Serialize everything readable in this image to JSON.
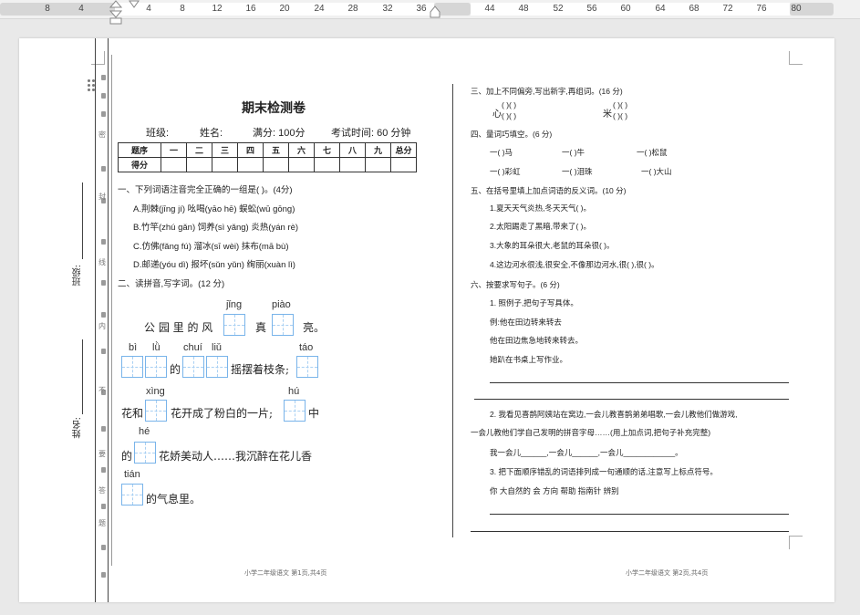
{
  "ruler": {
    "labels": [
      "8",
      "4",
      "4",
      "8",
      "12",
      "16",
      "20",
      "24",
      "28",
      "32",
      "36",
      "44",
      "48",
      "52",
      "56",
      "60",
      "64",
      "68",
      "72",
      "76",
      "80"
    ]
  },
  "exam": {
    "title": "期末检测卷",
    "info": {
      "class": "班级:",
      "name": "姓名:",
      "full_marks": "满分: 100分",
      "time": "考试时间: 60 分钟"
    },
    "score_table": {
      "row1": [
        "题序",
        "一",
        "二",
        "三",
        "四",
        "五",
        "六",
        "七",
        "八",
        "九",
        "总分"
      ],
      "row2": [
        "得分",
        "",
        "",
        "",
        "",
        "",
        "",
        "",
        "",
        "",
        ""
      ]
    }
  },
  "side": {
    "class_label": "班级:",
    "name_label": "姓名:",
    "seal_chars": [
      "密",
      "封",
      "线",
      "内",
      "不",
      "要",
      "答",
      "题"
    ]
  },
  "left": {
    "q1": {
      "title": "一、下列词语注音完全正确的一组是(    )。(4分)",
      "options": [
        "A.荆棘(jīng  jí)   吆喝(yāo  hē)   蜈蚣(wū  gōng)",
        "B.竹竿(zhú  gǎn)   饲养(sì  yǎng)   炎热(yán  rè)",
        "C.仿佛(fǎng  fú)   溜冰(sī  wèi)   抹布(mā  bù)",
        "D.邮递(yóu  dì)   报坏(sǔn  yǔn)   绚丽(xuàn  lì)"
      ]
    },
    "q2": {
      "title": "二、读拼音,写字词。(12 分)",
      "pinyin": {
        "jing": "jǐng",
        "piao": "piào",
        "bi": "bì",
        "lu": "lǜ",
        "chui": "chuí",
        "liu": "liǔ",
        "tao": "táo",
        "xing": "xìng",
        "hu": "hú",
        "he": "hé",
        "tian": "tián"
      },
      "text": {
        "l1a": "公 园 里 的 风",
        "l1b": "真",
        "l1c": "亮。",
        "l2a": "的",
        "l2b": "摇摆着枝条;",
        "l3a": "花和",
        "l3b": "花开成了粉白的一片;",
        "l3c": "中",
        "l4a": "的",
        "l4b": "花娇美动人……我沉醉在花儿香",
        "l5a": "的气息里。"
      }
    },
    "footer": "小学二年级语文  第1页,共4页"
  },
  "right": {
    "q3": {
      "title": "三、加上不同偏旁,写出新字,再组词。(16 分)",
      "char1": "心",
      "char2": "米",
      "blank": "(     )(     )"
    },
    "q4": {
      "title": "四、量词巧填空。(6 分)",
      "row1": [
        "一(      )马",
        "一(      )牛",
        "一(      )松鼠"
      ],
      "row2": [
        "一(      )彩虹",
        "一(      )泪珠",
        "一(      )大山"
      ]
    },
    "q5": {
      "title": "五、在括号里填上加点词语的反义词。(10 分)",
      "items": [
        "1.夏天天气炎热,冬天天气(      )。",
        "2.太阳踢走了黑暗,带来了(      )。",
        "3.大象的耳朵很大,老鼠的耳朵很(      )。",
        "4.这边河水很浅,很安全,不像那边河水,很(      ),很(      )。"
      ]
    },
    "q6": {
      "title": "六、按要求写句子。(6 分)",
      "s1": "1. 照例子,把句子写具体。",
      "ex1": "例:他在田边转来转去",
      "ex2": "他在田边焦急地转来转去。",
      "ex3": "她趴在书桌上写作业。",
      "s2a": "2. 我看见喜鹊阿姨站在窝边,一会儿教喜鹊弟弟唱歌,一会儿教他们做游戏,",
      "s2b": "一会儿教他们学自己发明的拼音字母……(用上加点词,把句子补充完整)",
      "s2c": "我一会儿______,一会儿______,一会儿____________。",
      "s3": "3. 把下面顺序错乱的词语排列成一句通顺的话,注意写上标点符号。",
      "words": "你    大自然的    会    方向    帮助    指南针    辨别"
    },
    "footer": "小学二年级语文  第2页,共4页"
  }
}
